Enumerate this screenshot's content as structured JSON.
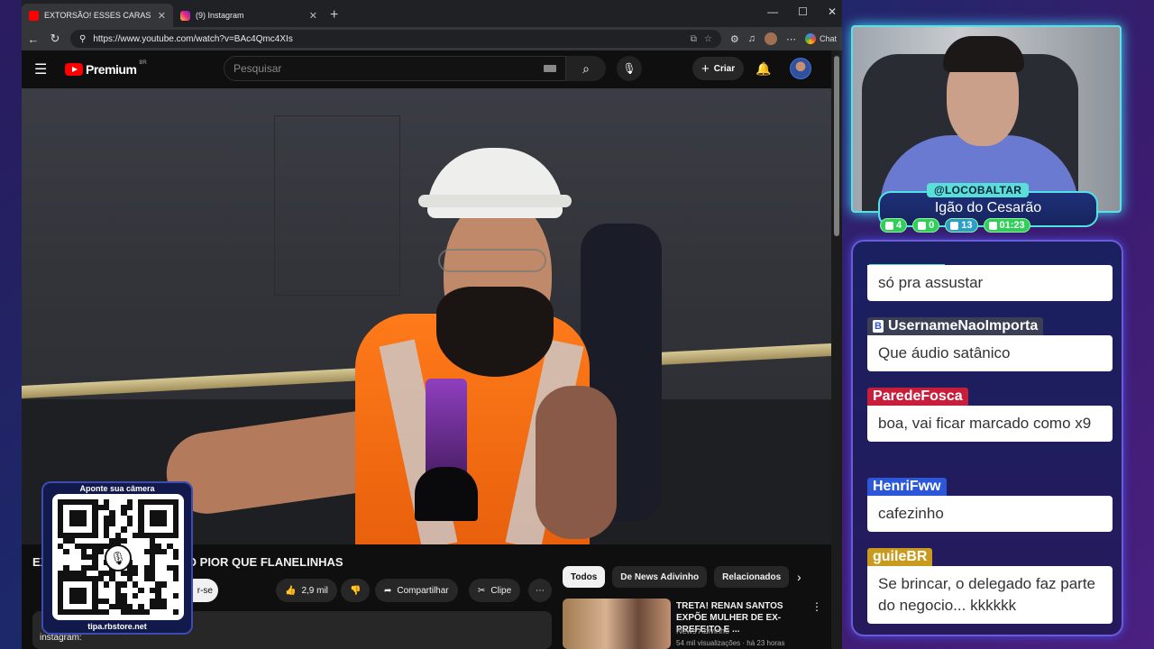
{
  "browser": {
    "tabs": [
      {
        "title": "EXTORSÃO! ESSES CARAS TÃO PIO",
        "active": true,
        "favicon": "youtube-icon"
      },
      {
        "title": "(9) Instagram",
        "active": false,
        "favicon": "instagram-icon"
      }
    ],
    "url": "https://www.youtube.com/watch?v=BAc4Qmc4XIs",
    "chat_label": "Chat"
  },
  "youtube": {
    "logo_word": "Premium",
    "logo_region": "BR",
    "search_placeholder": "Pesquisar",
    "create_label": "Criar",
    "video_title_visible": "EX",
    "video_title_tail": "TÃO PIOR QUE FLANELINHAS",
    "subscribe_partial": "r-se",
    "like_count": "2,9 mil",
    "share_label": "Compartilhar",
    "clip_label": "Clipe",
    "desc_text": "instagram:",
    "chips": [
      "Todos",
      "De News Adivinho",
      "Relacionados"
    ],
    "rec": {
      "title": "TRETA! RENAN SANTOS EXPÕE MULHER DE EX-PREFEITO E ...",
      "channel": "News Adivinho",
      "meta": "54 mil visualizações · há 23 horas"
    }
  },
  "qr": {
    "caption": "Aponte sua câmera",
    "url": "tipa.rbstore.net"
  },
  "streamer": {
    "handle": "@LOCOBALTAR",
    "name": "Igão do Cesarão",
    "stats": [
      "4",
      "0",
      "13",
      "01:23"
    ]
  },
  "chat": {
    "messages": [
      {
        "user": "",
        "text": "só pra assustar",
        "color": "#1a2060"
      },
      {
        "user": "UsernameNaoImporta",
        "text": "Que áudio satânico",
        "color": "#3b3f55"
      },
      {
        "user": "ParedeFosca",
        "text": "boa, vai ficar marcado como x9",
        "color": "#c81e3c"
      },
      {
        "user": "HenriFww",
        "text": "cafezinho",
        "color": "#2b57d8"
      },
      {
        "user": "guileBR",
        "text": "Se brincar, o delegado faz parte do negocio... kkkkkk",
        "color": "#c89a1e"
      }
    ]
  }
}
